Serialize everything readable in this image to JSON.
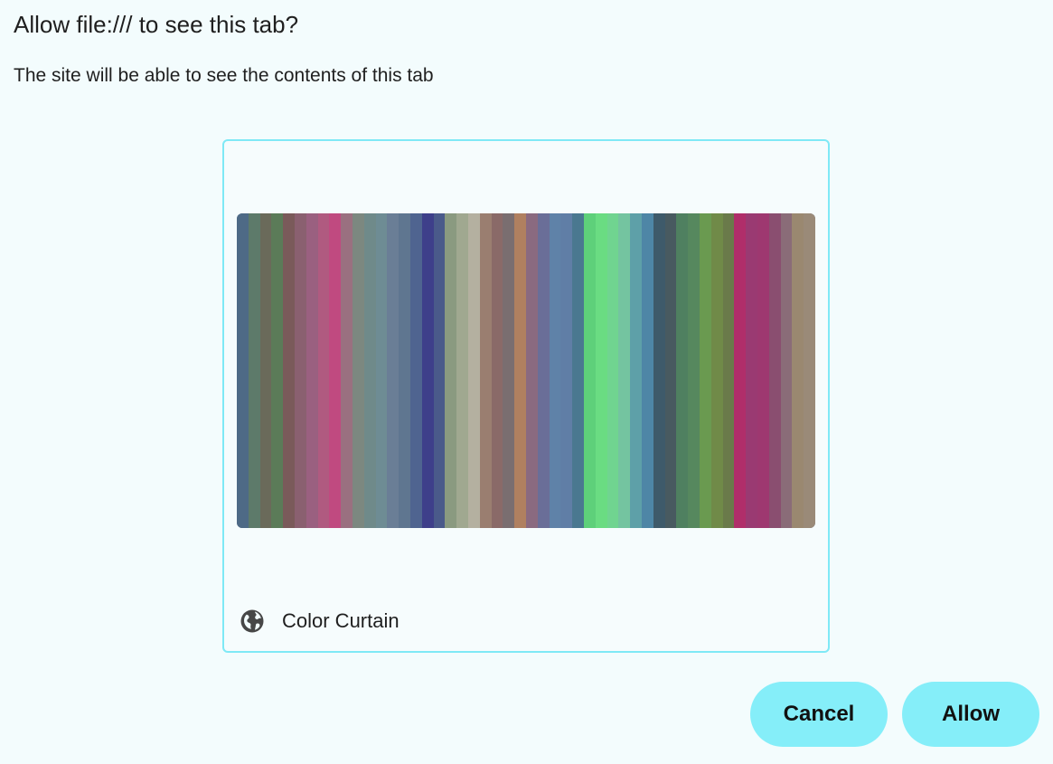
{
  "dialog": {
    "title": "Allow file:/// to see this tab?",
    "subtitle": "The site will be able to see the contents of this tab"
  },
  "tab": {
    "title": "Color Curtain",
    "icon": "globe-icon",
    "preview_colors": [
      "#4e6a86",
      "#5d7a6a",
      "#6a6a5a",
      "#5b7b58",
      "#7a5a5a",
      "#8a6070",
      "#9a6080",
      "#b05a80",
      "#c04a80",
      "#9a7080",
      "#7c8880",
      "#6f8a8a",
      "#6e8c94",
      "#6a7e96",
      "#5f7690",
      "#4f6490",
      "#3e3f8a",
      "#4a5a8a",
      "#8a9a80",
      "#a0a890",
      "#b4b0a0",
      "#9a7e70",
      "#8a6a68",
      "#7a6e70",
      "#b08060",
      "#8a6a80",
      "#6a6e98",
      "#5f82a8",
      "#607ea6",
      "#4a7890",
      "#5ed07a",
      "#6adc82",
      "#70d490",
      "#74c4a0",
      "#5ea0a8",
      "#4e86a6",
      "#3e5a6a",
      "#485a60",
      "#4f8060",
      "#56885e",
      "#6a9a50",
      "#708a48",
      "#6a7a4a",
      "#b02e6a",
      "#9a3a72",
      "#9e3870",
      "#8a4e70",
      "#8a6c78",
      "#9a8870",
      "#9a8a78"
    ]
  },
  "buttons": {
    "cancel": "Cancel",
    "allow": "Allow"
  },
  "colors": {
    "background": "#f3fcfd",
    "accent": "#85eef9",
    "card_border": "#7fe9f6"
  }
}
